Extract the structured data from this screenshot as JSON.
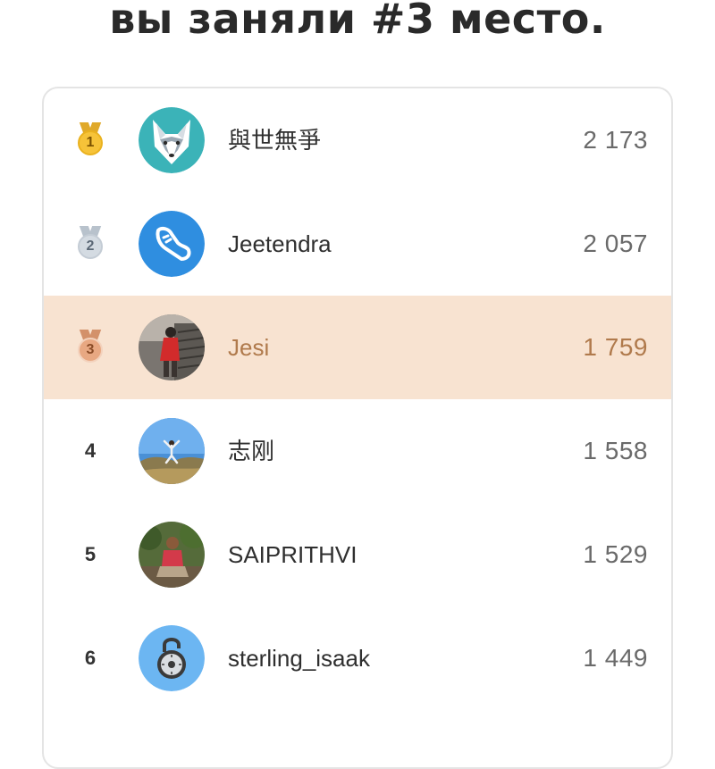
{
  "headline": "вы заняли #3 место.",
  "leaderboard": [
    {
      "rank": "1",
      "medal": "gold",
      "name": "與世無爭",
      "score": "2 173",
      "avatar": "wolf-avatar"
    },
    {
      "rank": "2",
      "medal": "silver",
      "name": "Jeetendra",
      "score": "2 057",
      "avatar": "shoe-avatar"
    },
    {
      "rank": "3",
      "medal": "bronze",
      "name": "Jesi",
      "score": "1 759",
      "avatar": "photo-avatar-red-outfit",
      "current_user": true
    },
    {
      "rank": "4",
      "name": "志刚",
      "score": "1 558",
      "avatar": "photo-avatar-jumping"
    },
    {
      "rank": "5",
      "name": "SAIPRITHVI",
      "score": "1 529",
      "avatar": "photo-avatar-seated-man"
    },
    {
      "rank": "6",
      "name": "sterling_isaak",
      "score": "1 449",
      "avatar": "padlock-avatar"
    }
  ],
  "colors": {
    "highlight_row": "#f8e3d1",
    "highlight_text": "#b07a4c"
  }
}
